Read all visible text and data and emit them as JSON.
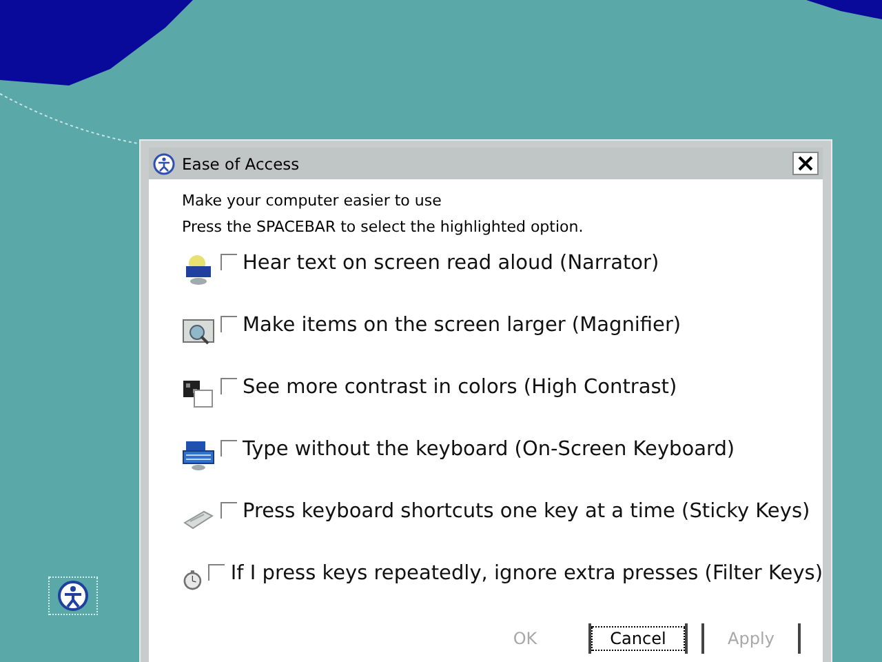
{
  "window": {
    "title": "Ease of Access"
  },
  "intro": [
    "Make your computer easier to use",
    "Press the SPACEBAR to select the highlighted option."
  ],
  "options": [
    {
      "label": "Hear text on screen read aloud (Narrator)",
      "checked": false
    },
    {
      "label": "Make items on the screen larger (Magnifier)",
      "checked": false
    },
    {
      "label": "See more contrast in colors (High Contrast)",
      "checked": false
    },
    {
      "label": "Type without the keyboard (On-Screen Keyboard)",
      "checked": false
    },
    {
      "label": "Press keyboard shortcuts one key at a time (Sticky Keys)",
      "checked": false
    },
    {
      "label": "If I press keys repeatedly, ignore extra presses (Filter Keys)",
      "checked": false
    }
  ],
  "buttons": [
    {
      "label": "OK",
      "disabled": true,
      "focused": false
    },
    {
      "label": "Cancel",
      "disabled": false,
      "focused": true
    },
    {
      "label": "Apply",
      "disabled": true,
      "focused": false
    }
  ]
}
